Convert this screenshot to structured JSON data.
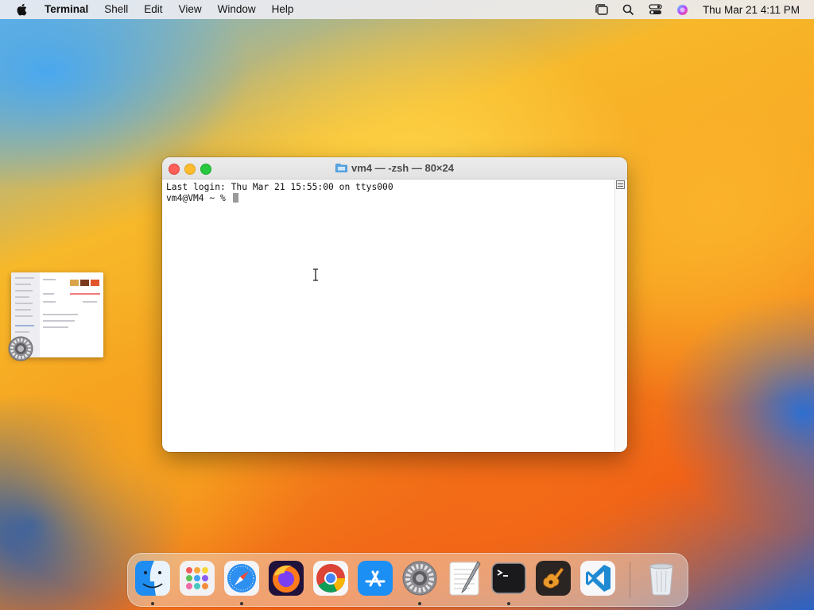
{
  "menubar": {
    "app_name": "Terminal",
    "menus": [
      "Shell",
      "Edit",
      "View",
      "Window",
      "Help"
    ],
    "clock": "Thu Mar 21  4:11 PM",
    "status_icons": [
      "stage-manager-icon",
      "spotlight-search-icon",
      "control-center-icon",
      "siri-icon"
    ]
  },
  "terminal": {
    "title": "vm4 — -zsh — 80×24",
    "lines": [
      "Last login: Thu Mar 21 15:55:00 on ttys000",
      "vm4@VM4 ~ % "
    ]
  },
  "colors": {
    "close": "#fe5f57",
    "minimize": "#febc2e",
    "zoom": "#28c840"
  },
  "dock": {
    "apps": [
      "finder-icon",
      "launchpad-icon",
      "safari-icon",
      "firefox-icon",
      "chrome-icon",
      "app-store-icon",
      "system-settings-icon",
      "textedit-icon",
      "terminal-icon",
      "garageband-icon",
      "vscode-icon",
      "trash-icon"
    ],
    "running": [
      "finder-icon",
      "safari-icon",
      "system-settings-icon",
      "terminal-icon"
    ]
  }
}
